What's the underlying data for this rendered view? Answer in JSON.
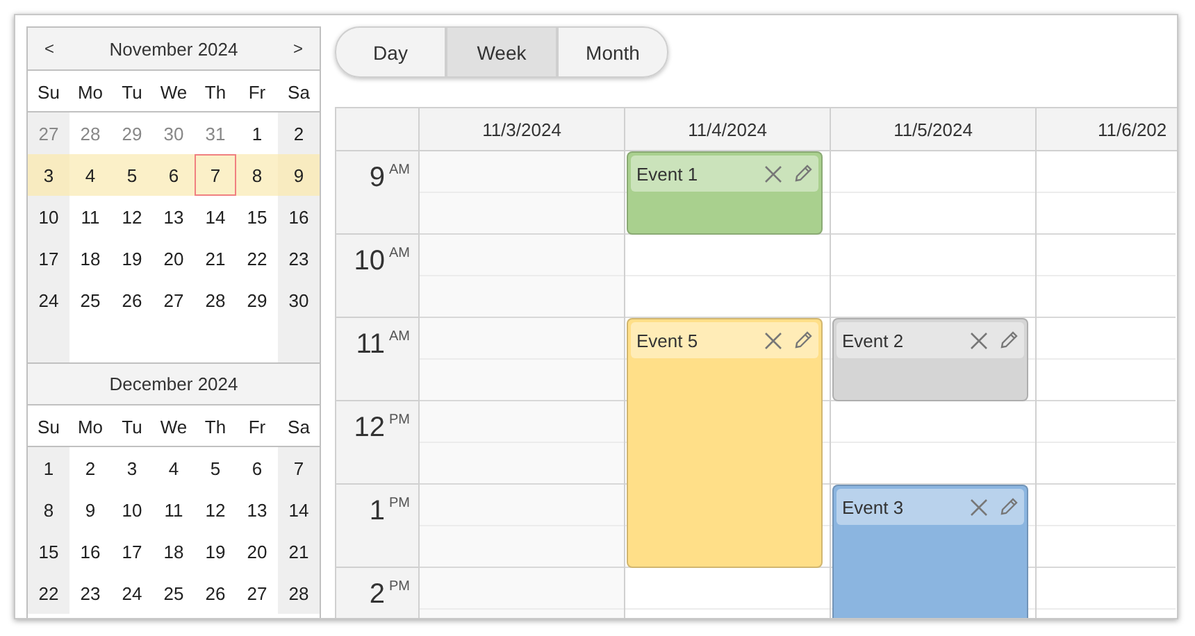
{
  "navigator": {
    "months": [
      {
        "title": "November 2024",
        "prev": "<",
        "next": ">",
        "weekdays": [
          "Su",
          "Mo",
          "Tu",
          "We",
          "Th",
          "Fr",
          "Sa"
        ],
        "weeks": [
          {
            "selected": false,
            "days": [
              {
                "day": "27",
                "other_month": true,
                "today": false
              },
              {
                "day": "28",
                "other_month": true,
                "today": false
              },
              {
                "day": "29",
                "other_month": true,
                "today": false
              },
              {
                "day": "30",
                "other_month": true,
                "today": false
              },
              {
                "day": "31",
                "other_month": true,
                "today": false
              },
              {
                "day": "1",
                "other_month": false,
                "today": false
              },
              {
                "day": "2",
                "other_month": false,
                "today": false
              }
            ]
          },
          {
            "selected": true,
            "days": [
              {
                "day": "3",
                "other_month": false,
                "today": false
              },
              {
                "day": "4",
                "other_month": false,
                "today": false
              },
              {
                "day": "5",
                "other_month": false,
                "today": false
              },
              {
                "day": "6",
                "other_month": false,
                "today": false
              },
              {
                "day": "7",
                "other_month": false,
                "today": true
              },
              {
                "day": "8",
                "other_month": false,
                "today": false
              },
              {
                "day": "9",
                "other_month": false,
                "today": false
              }
            ]
          },
          {
            "selected": false,
            "days": [
              {
                "day": "10",
                "other_month": false,
                "today": false
              },
              {
                "day": "11",
                "other_month": false,
                "today": false
              },
              {
                "day": "12",
                "other_month": false,
                "today": false
              },
              {
                "day": "13",
                "other_month": false,
                "today": false
              },
              {
                "day": "14",
                "other_month": false,
                "today": false
              },
              {
                "day": "15",
                "other_month": false,
                "today": false
              },
              {
                "day": "16",
                "other_month": false,
                "today": false
              }
            ]
          },
          {
            "selected": false,
            "days": [
              {
                "day": "17",
                "other_month": false,
                "today": false
              },
              {
                "day": "18",
                "other_month": false,
                "today": false
              },
              {
                "day": "19",
                "other_month": false,
                "today": false
              },
              {
                "day": "20",
                "other_month": false,
                "today": false
              },
              {
                "day": "21",
                "other_month": false,
                "today": false
              },
              {
                "day": "22",
                "other_month": false,
                "today": false
              },
              {
                "day": "23",
                "other_month": false,
                "today": false
              }
            ]
          },
          {
            "selected": false,
            "days": [
              {
                "day": "24",
                "other_month": false,
                "today": false
              },
              {
                "day": "25",
                "other_month": false,
                "today": false
              },
              {
                "day": "26",
                "other_month": false,
                "today": false
              },
              {
                "day": "27",
                "other_month": false,
                "today": false
              },
              {
                "day": "28",
                "other_month": false,
                "today": false
              },
              {
                "day": "29",
                "other_month": false,
                "today": false
              },
              {
                "day": "30",
                "other_month": false,
                "today": false
              }
            ]
          }
        ]
      },
      {
        "title": "December 2024",
        "weekdays": [
          "Su",
          "Mo",
          "Tu",
          "We",
          "Th",
          "Fr",
          "Sa"
        ],
        "weeks": [
          {
            "selected": false,
            "days": [
              {
                "day": "1",
                "other_month": false,
                "today": false
              },
              {
                "day": "2",
                "other_month": false,
                "today": false
              },
              {
                "day": "3",
                "other_month": false,
                "today": false
              },
              {
                "day": "4",
                "other_month": false,
                "today": false
              },
              {
                "day": "5",
                "other_month": false,
                "today": false
              },
              {
                "day": "6",
                "other_month": false,
                "today": false
              },
              {
                "day": "7",
                "other_month": false,
                "today": false
              }
            ]
          },
          {
            "selected": false,
            "days": [
              {
                "day": "8",
                "other_month": false,
                "today": false
              },
              {
                "day": "9",
                "other_month": false,
                "today": false
              },
              {
                "day": "10",
                "other_month": false,
                "today": false
              },
              {
                "day": "11",
                "other_month": false,
                "today": false
              },
              {
                "day": "12",
                "other_month": false,
                "today": false
              },
              {
                "day": "13",
                "other_month": false,
                "today": false
              },
              {
                "day": "14",
                "other_month": false,
                "today": false
              }
            ]
          },
          {
            "selected": false,
            "days": [
              {
                "day": "15",
                "other_month": false,
                "today": false
              },
              {
                "day": "16",
                "other_month": false,
                "today": false
              },
              {
                "day": "17",
                "other_month": false,
                "today": false
              },
              {
                "day": "18",
                "other_month": false,
                "today": false
              },
              {
                "day": "19",
                "other_month": false,
                "today": false
              },
              {
                "day": "20",
                "other_month": false,
                "today": false
              },
              {
                "day": "21",
                "other_month": false,
                "today": false
              }
            ]
          },
          {
            "selected": false,
            "days": [
              {
                "day": "22",
                "other_month": false,
                "today": false
              },
              {
                "day": "23",
                "other_month": false,
                "today": false
              },
              {
                "day": "24",
                "other_month": false,
                "today": false
              },
              {
                "day": "25",
                "other_month": false,
                "today": false
              },
              {
                "day": "26",
                "other_month": false,
                "today": false
              },
              {
                "day": "27",
                "other_month": false,
                "today": false
              },
              {
                "day": "28",
                "other_month": false,
                "today": false
              }
            ]
          }
        ]
      }
    ]
  },
  "view_buttons": [
    {
      "label": "Day",
      "selected": false
    },
    {
      "label": "Week",
      "selected": true
    },
    {
      "label": "Month",
      "selected": false
    }
  ],
  "calendar": {
    "columns": [
      "11/3/2024",
      "11/4/2024",
      "11/5/2024",
      "11/6/202"
    ],
    "events": [
      {
        "title": "Event 1",
        "color": "#a9d08e"
      },
      {
        "title": "Event 5",
        "color": "#ffdf88"
      },
      {
        "title": "Event 2",
        "color": "#d5d5d5"
      },
      {
        "title": "Event 3",
        "color": "#8bb5e0"
      }
    ],
    "hours": [
      {
        "hour": "9",
        "period": "AM"
      },
      {
        "hour": "10",
        "period": "AM"
      },
      {
        "hour": "11",
        "period": "AM"
      },
      {
        "hour": "12",
        "period": "PM"
      },
      {
        "hour": "1",
        "period": "PM"
      },
      {
        "hour": "2",
        "period": "PM"
      }
    ]
  }
}
